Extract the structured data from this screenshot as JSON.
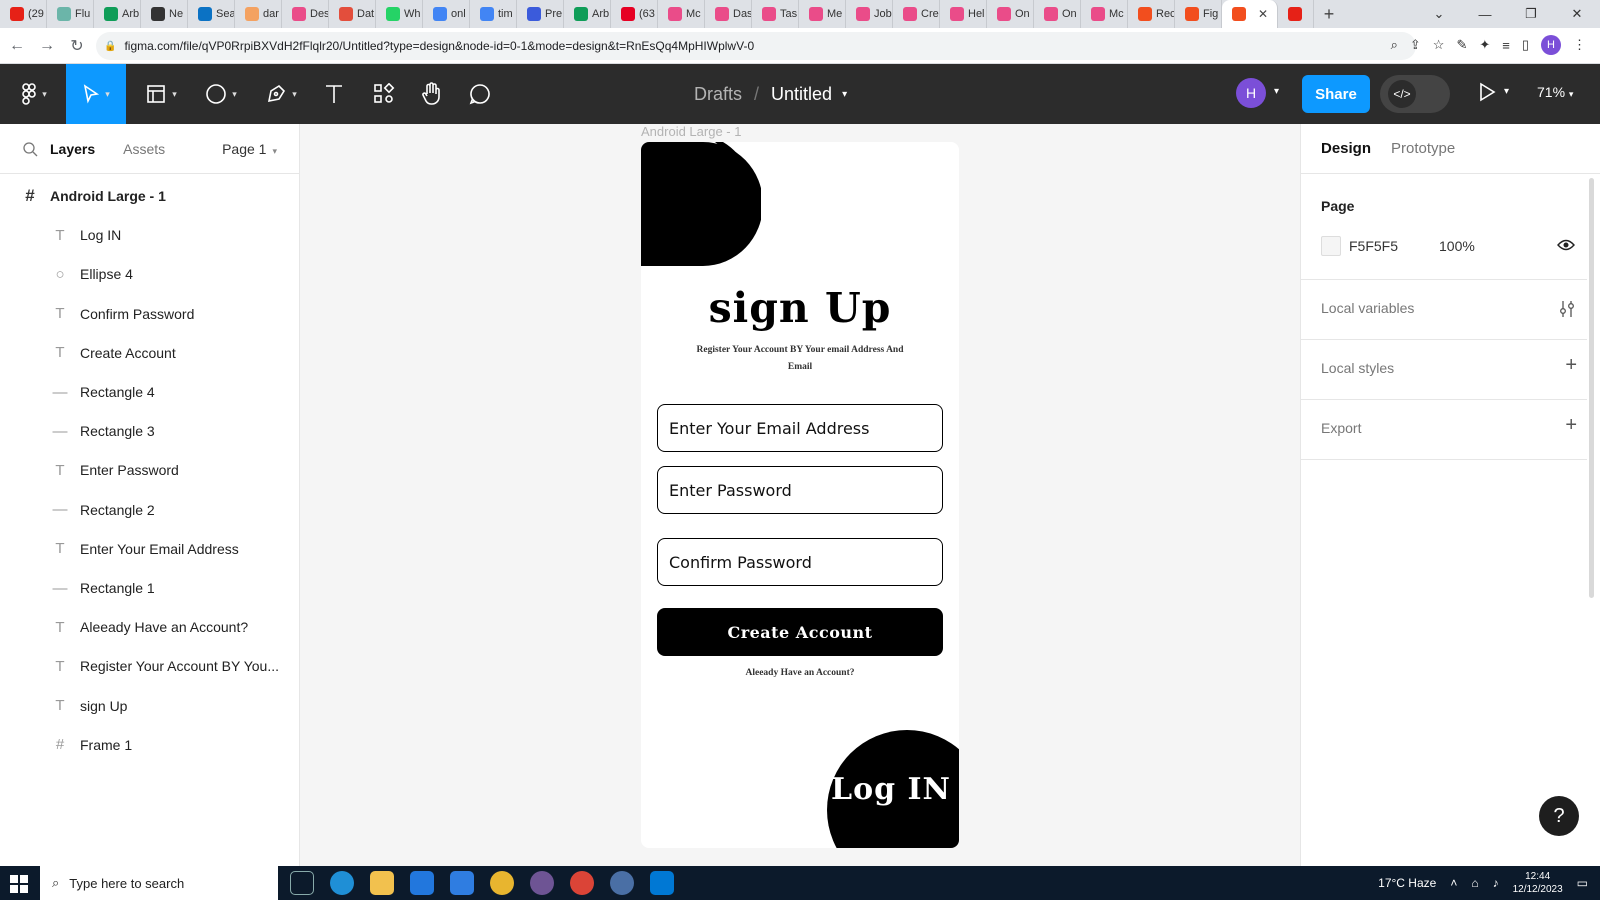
{
  "browser": {
    "tabs": [
      {
        "label": "(29",
        "color": "#e62117"
      },
      {
        "label": "Flu",
        "color": "#6bb5a9"
      },
      {
        "label": "Arb",
        "color": "#0f9d58"
      },
      {
        "label": "Ne",
        "color": "#333333"
      },
      {
        "label": "Sea",
        "color": "#0b72c4"
      },
      {
        "label": "dar",
        "color": "#f4a261"
      },
      {
        "label": "Des",
        "color": "#ea4c89"
      },
      {
        "label": "Dat",
        "color": "#e34e3c"
      },
      {
        "label": "Wh",
        "color": "#25d366"
      },
      {
        "label": "onl",
        "color": "#4285f4"
      },
      {
        "label": "tim",
        "color": "#4285f4"
      },
      {
        "label": "Pre",
        "color": "#3b5bdb"
      },
      {
        "label": "Arb",
        "color": "#0f9d58"
      },
      {
        "label": "(63",
        "color": "#e60023"
      },
      {
        "label": "Mc",
        "color": "#ea4c89"
      },
      {
        "label": "Das",
        "color": "#ea4c89"
      },
      {
        "label": "Tas",
        "color": "#ea4c89"
      },
      {
        "label": "Me",
        "color": "#ea4c89"
      },
      {
        "label": "Job",
        "color": "#ea4c89"
      },
      {
        "label": "Cre",
        "color": "#ea4c89"
      },
      {
        "label": "Hel",
        "color": "#ea4c89"
      },
      {
        "label": "On",
        "color": "#ea4c89"
      },
      {
        "label": "On",
        "color": "#ea4c89"
      },
      {
        "label": "Mc",
        "color": "#ea4c89"
      },
      {
        "label": "Rec",
        "color": "#f24e1e"
      },
      {
        "label": "Fig",
        "color": "#f24e1e"
      }
    ],
    "url": "figma.com/file/qVP0RrpiBXVdH2fFlqlr20/Untitled?type=design&node-id=0-1&mode=design&t=RnEsQq4MpHIWplwV-0",
    "profile_initial": "H"
  },
  "toolbar": {
    "breadcrumb_parent": "Drafts",
    "breadcrumb_sep": "/",
    "file_name": "Untitled",
    "user_initial": "H",
    "share_label": "Share",
    "zoom": "71%"
  },
  "left_panel": {
    "tab_layers": "Layers",
    "tab_assets": "Assets",
    "page_selector": "Page 1",
    "layers": [
      {
        "name": "Android Large - 1",
        "icon": "frame-icon",
        "glyph": "#",
        "indent": 0
      },
      {
        "name": "Log IN",
        "icon": "text-icon",
        "glyph": "T",
        "indent": 1
      },
      {
        "name": "Ellipse 4",
        "icon": "ellipse-icon",
        "glyph": "○",
        "indent": 1
      },
      {
        "name": "Confirm Password",
        "icon": "text-icon",
        "glyph": "T",
        "indent": 1
      },
      {
        "name": "Create Account",
        "icon": "text-icon",
        "glyph": "T",
        "indent": 1
      },
      {
        "name": "Rectangle 4",
        "icon": "rectangle-icon",
        "glyph": "—",
        "indent": 1
      },
      {
        "name": "Rectangle 3",
        "icon": "rectangle-icon",
        "glyph": "—",
        "indent": 1
      },
      {
        "name": "Enter Password",
        "icon": "text-icon",
        "glyph": "T",
        "indent": 1
      },
      {
        "name": "Rectangle 2",
        "icon": "rectangle-icon",
        "glyph": "—",
        "indent": 1
      },
      {
        "name": "Enter Your Email Address",
        "icon": "text-icon",
        "glyph": "T",
        "indent": 1
      },
      {
        "name": "Rectangle 1",
        "icon": "rectangle-icon",
        "glyph": "—",
        "indent": 1
      },
      {
        "name": "Aleeady Have an Account?",
        "icon": "text-icon",
        "glyph": "T",
        "indent": 1
      },
      {
        "name": "Register Your Account BY You...",
        "icon": "text-icon",
        "glyph": "T",
        "indent": 1
      },
      {
        "name": "sign Up",
        "icon": "text-icon",
        "glyph": "T",
        "indent": 1
      },
      {
        "name": "Frame 1",
        "icon": "frame-icon",
        "glyph": "#",
        "indent": 1
      }
    ]
  },
  "canvas": {
    "frame_label": "Android Large - 1",
    "title": "sign Up",
    "subtitle": "Register Your Account BY Your email Address And Email",
    "email_placeholder": "Enter Your Email Address",
    "password_placeholder": "Enter Password",
    "confirm_placeholder": "Confirm Password",
    "create_button": "Create Account",
    "have_account": "Aleeady Have an Account?",
    "login": "Log IN"
  },
  "right_panel": {
    "tab_design": "Design",
    "tab_prototype": "Prototype",
    "page_heading": "Page",
    "page_color": "F5F5F5",
    "page_opacity": "100%",
    "sections": [
      "Local variables",
      "Local styles",
      "Export"
    ],
    "help": "?"
  },
  "taskbar": {
    "search_placeholder": "Type here to search",
    "weather": "17°C  Haze",
    "time": "12:44",
    "date": "12/12/2023"
  }
}
